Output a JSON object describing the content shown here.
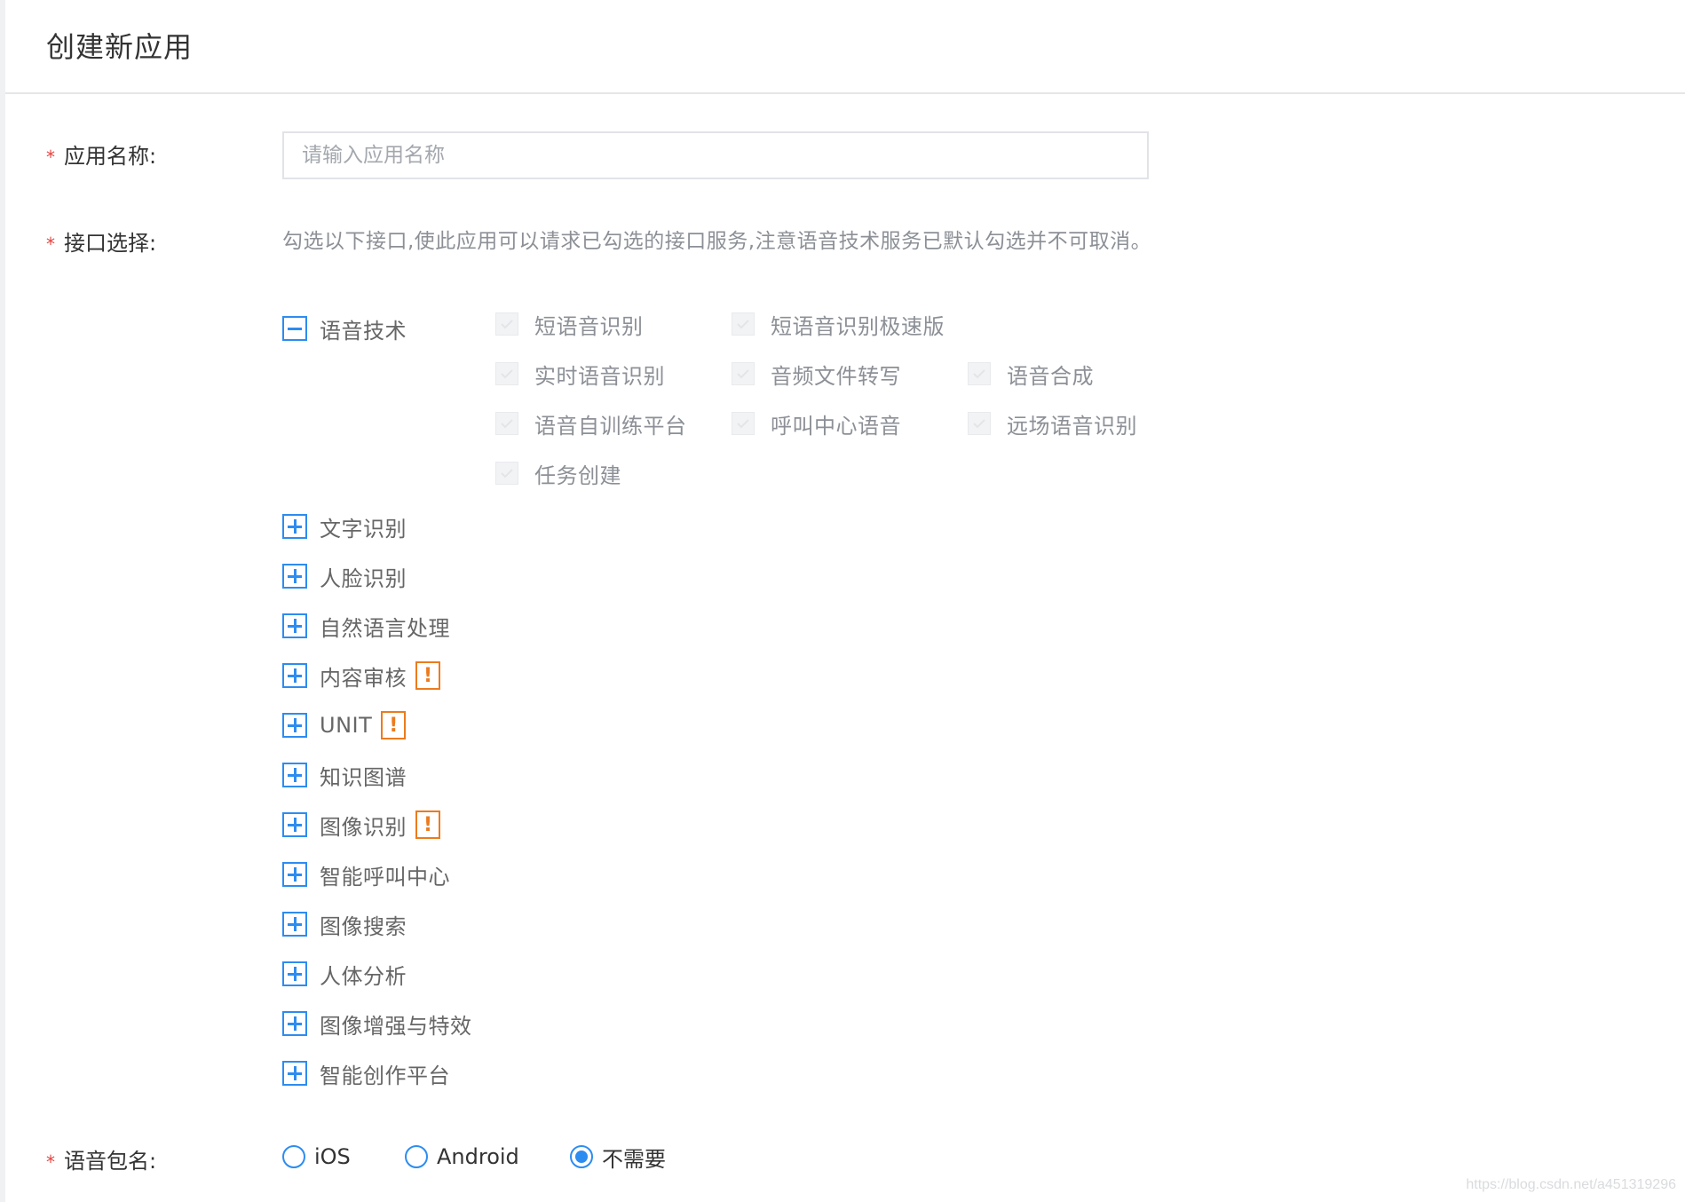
{
  "page": {
    "title": "创建新应用"
  },
  "form": {
    "app_name": {
      "required_mark": "*",
      "label": "应用名称:",
      "value": "",
      "placeholder": "请输入应用名称"
    },
    "api_select": {
      "required_mark": "*",
      "label": "接口选择:",
      "hint": "勾选以下接口,使此应用可以请求已勾选的接口服务,注意语音技术服务已默认勾选并不可取消。",
      "expanded_category": {
        "label": "语音技术",
        "icon": "collapse-minus-icon",
        "options": [
          {
            "label": "短语音识别",
            "checked": true,
            "disabled": true
          },
          {
            "label": "短语音识别极速版",
            "checked": true,
            "disabled": true
          },
          {
            "label": "实时语音识别",
            "checked": true,
            "disabled": true
          },
          {
            "label": "音频文件转写",
            "checked": true,
            "disabled": true
          },
          {
            "label": "语音合成",
            "checked": true,
            "disabled": true
          },
          {
            "label": "语音自训练平台",
            "checked": true,
            "disabled": true
          },
          {
            "label": "呼叫中心语音",
            "checked": true,
            "disabled": true
          },
          {
            "label": "远场语音识别",
            "checked": true,
            "disabled": true
          },
          {
            "label": "任务创建",
            "checked": true,
            "disabled": true
          }
        ]
      },
      "collapsed_categories": [
        {
          "label": "文字识别",
          "warning": false
        },
        {
          "label": "人脸识别",
          "warning": false
        },
        {
          "label": "自然语言处理",
          "warning": false
        },
        {
          "label": "内容审核",
          "warning": true
        },
        {
          "label": "UNIT",
          "warning": true
        },
        {
          "label": "知识图谱",
          "warning": false
        },
        {
          "label": "图像识别",
          "warning": true
        },
        {
          "label": "智能呼叫中心",
          "warning": false
        },
        {
          "label": "图像搜索",
          "warning": false
        },
        {
          "label": "人体分析",
          "warning": false
        },
        {
          "label": "图像增强与特效",
          "warning": false
        },
        {
          "label": "智能创作平台",
          "warning": false
        }
      ],
      "warning_glyph": "!"
    },
    "package_name": {
      "required_mark": "*",
      "label": "语音包名:",
      "options": [
        {
          "label": "iOS",
          "selected": false
        },
        {
          "label": "Android",
          "selected": false
        },
        {
          "label": "不需要",
          "selected": true
        }
      ]
    }
  },
  "watermark": "https://blog.csdn.net/a451319296",
  "colors": {
    "accent": "#2d8cf0",
    "required": "#e64340",
    "warning": "#ec7b1d"
  }
}
